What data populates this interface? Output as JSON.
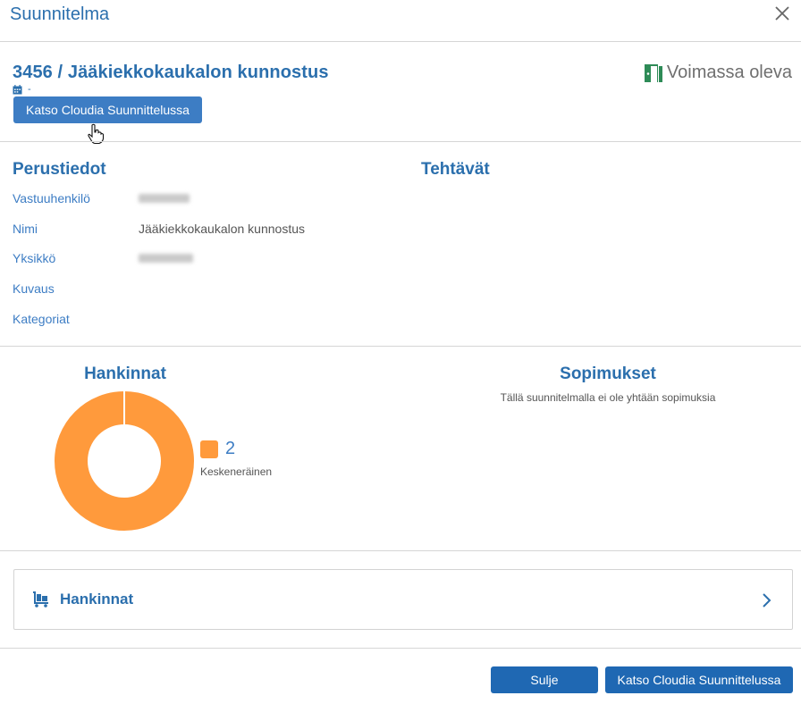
{
  "dialog": {
    "title": "Suunnitelma"
  },
  "plan": {
    "title": "3456 / Jääkiekkokaukalon kunnostus",
    "date": "-",
    "open_button": "Katso Cloudia Suunnittelussa",
    "status": "Voimassa oleva",
    "status_color": "#2e8b57"
  },
  "basic_info": {
    "title": "Perustiedot",
    "fields": [
      {
        "label": "Vastuuhenkilö",
        "value": ""
      },
      {
        "label": "Nimi",
        "value": "Jääkiekkokaukalon kunnostus"
      },
      {
        "label": "Yksikkö",
        "value": ""
      },
      {
        "label": "Kuvaus",
        "value": ""
      },
      {
        "label": "Kategoriat",
        "value": ""
      }
    ]
  },
  "tasks": {
    "title": "Tehtävät"
  },
  "purchases_chart": {
    "title": "Hankinnat",
    "legend_count": "2",
    "legend_label": "Keskeneräinen",
    "color": "#ff9a3c"
  },
  "chart_data": {
    "type": "pie",
    "categories": [
      "Keskeneräinen"
    ],
    "values": [
      2
    ]
  },
  "contracts": {
    "title": "Sopimukset",
    "empty_text": "Tällä suunnitelmalla ei ole yhtään sopimuksia"
  },
  "accordion": {
    "label": "Hankinnat"
  },
  "footer": {
    "close_label": "Sulje",
    "open_label": "Katso Cloudia Suunnittelussa"
  }
}
